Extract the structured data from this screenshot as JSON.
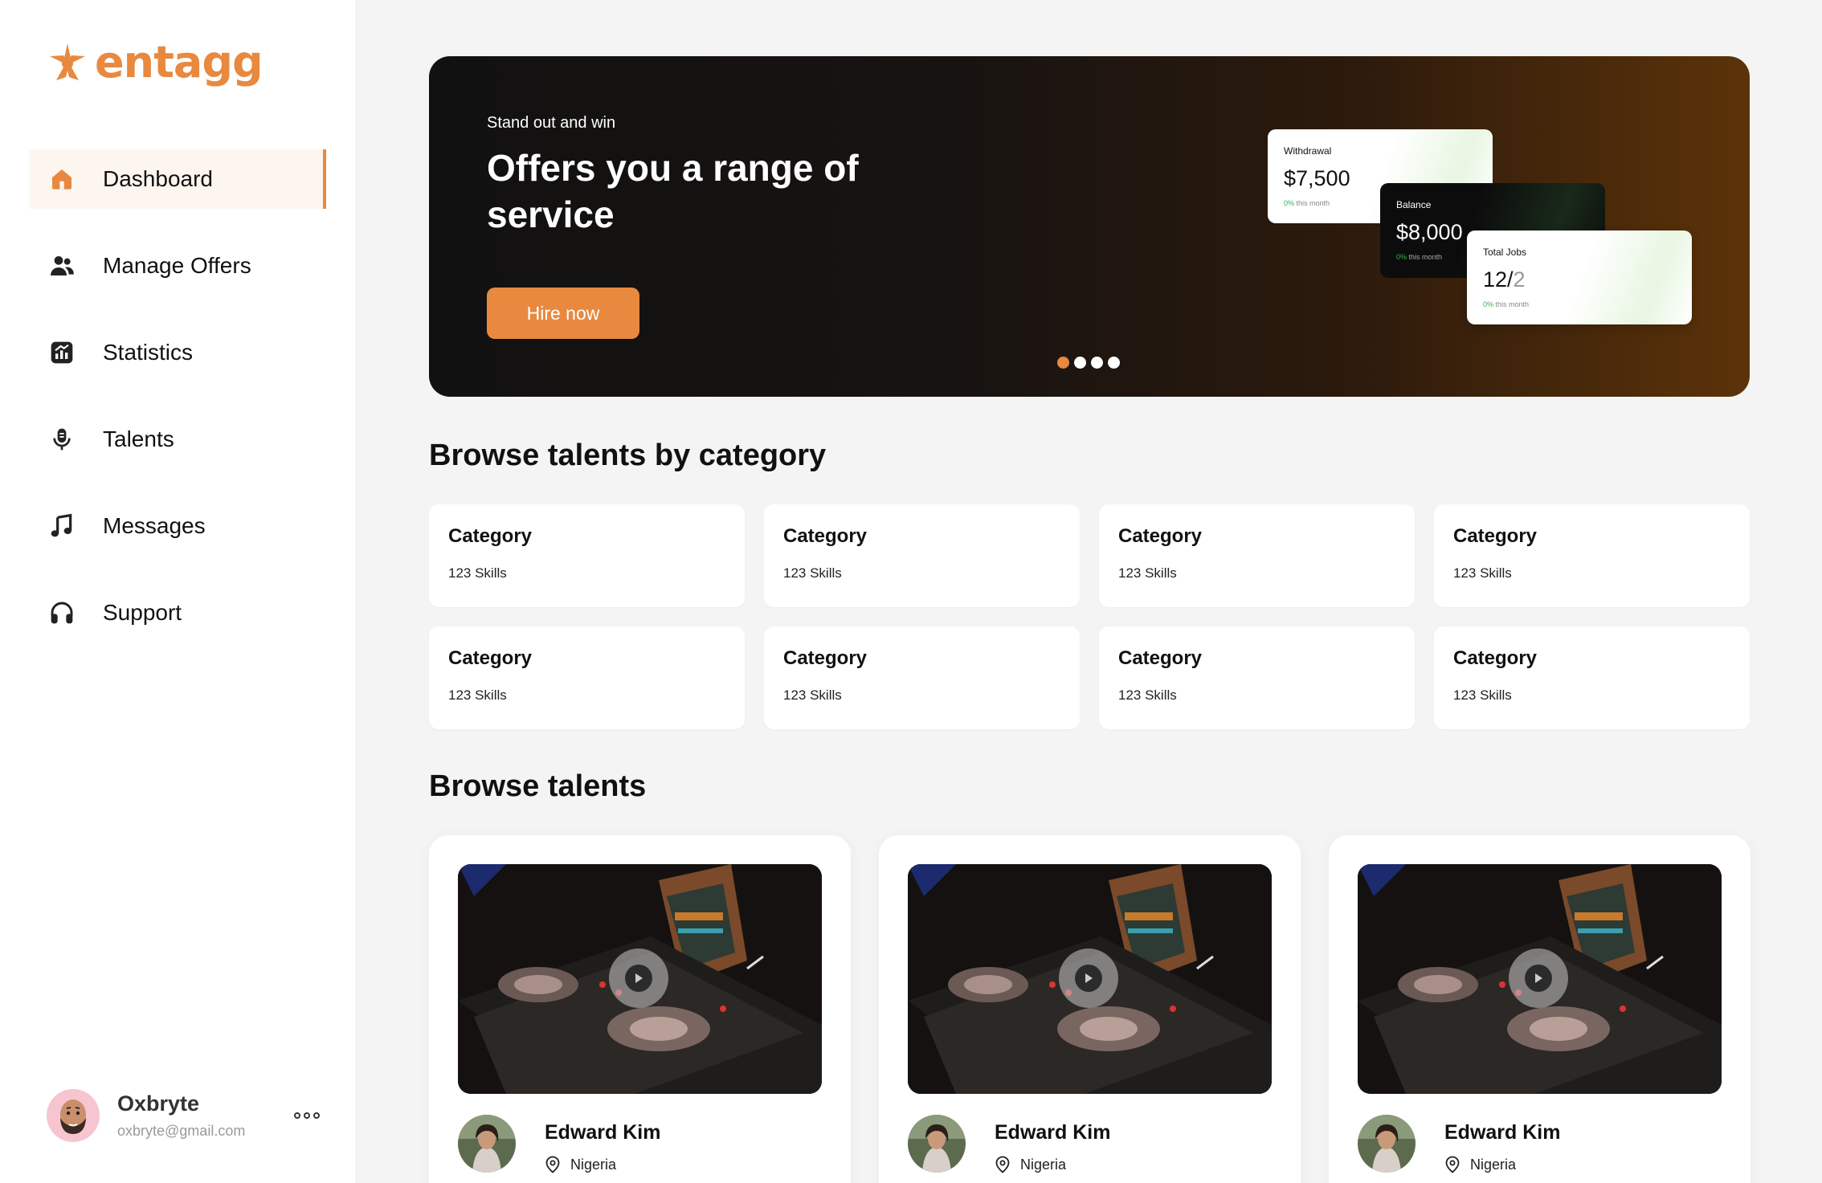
{
  "brand": {
    "name": "entagg",
    "color": "#e8893f"
  },
  "sidebar": {
    "items": [
      {
        "label": "Dashboard",
        "icon": "home-icon",
        "active": true
      },
      {
        "label": "Manage Offers",
        "icon": "users-icon",
        "active": false
      },
      {
        "label": "Statistics",
        "icon": "chart-icon",
        "active": false
      },
      {
        "label": "Talents",
        "icon": "microphone-icon",
        "active": false
      },
      {
        "label": "Messages",
        "icon": "music-note-icon",
        "active": false
      },
      {
        "label": "Support",
        "icon": "headphones-icon",
        "active": false
      }
    ],
    "user": {
      "name": "Oxbryte",
      "email": "oxbryte@gmail.com"
    }
  },
  "banner": {
    "kicker": "Stand out and win",
    "title": "Offers you a range of service",
    "cta": "Hire now",
    "slides": 4,
    "active_slide": 1,
    "cards": {
      "withdrawal": {
        "label": "Withdrawal",
        "value": "$7,500",
        "change": "0%",
        "change_text": "this month"
      },
      "balance": {
        "label": "Balance",
        "value": "$8,000",
        "change": "0%",
        "change_text": "this month"
      },
      "total_jobs": {
        "label": "Total Jobs",
        "value_main": "12/",
        "value_rest": "2",
        "change": "0%",
        "change_text": "this month"
      }
    }
  },
  "categories_section": {
    "title": "Browse talents by category",
    "items": [
      {
        "name": "Category",
        "skills": "123 Skills"
      },
      {
        "name": "Category",
        "skills": "123 Skills"
      },
      {
        "name": "Category",
        "skills": "123 Skills"
      },
      {
        "name": "Category",
        "skills": "123 Skills"
      },
      {
        "name": "Category",
        "skills": "123 Skills"
      },
      {
        "name": "Category",
        "skills": "123 Skills"
      },
      {
        "name": "Category",
        "skills": "123 Skills"
      },
      {
        "name": "Category",
        "skills": "123 Skills"
      }
    ]
  },
  "talents_section": {
    "title": "Browse talents",
    "items": [
      {
        "name": "Edward Kim",
        "location": "Nigeria"
      },
      {
        "name": "Edward Kim",
        "location": "Nigeria"
      },
      {
        "name": "Edward Kim",
        "location": "Nigeria"
      }
    ]
  }
}
